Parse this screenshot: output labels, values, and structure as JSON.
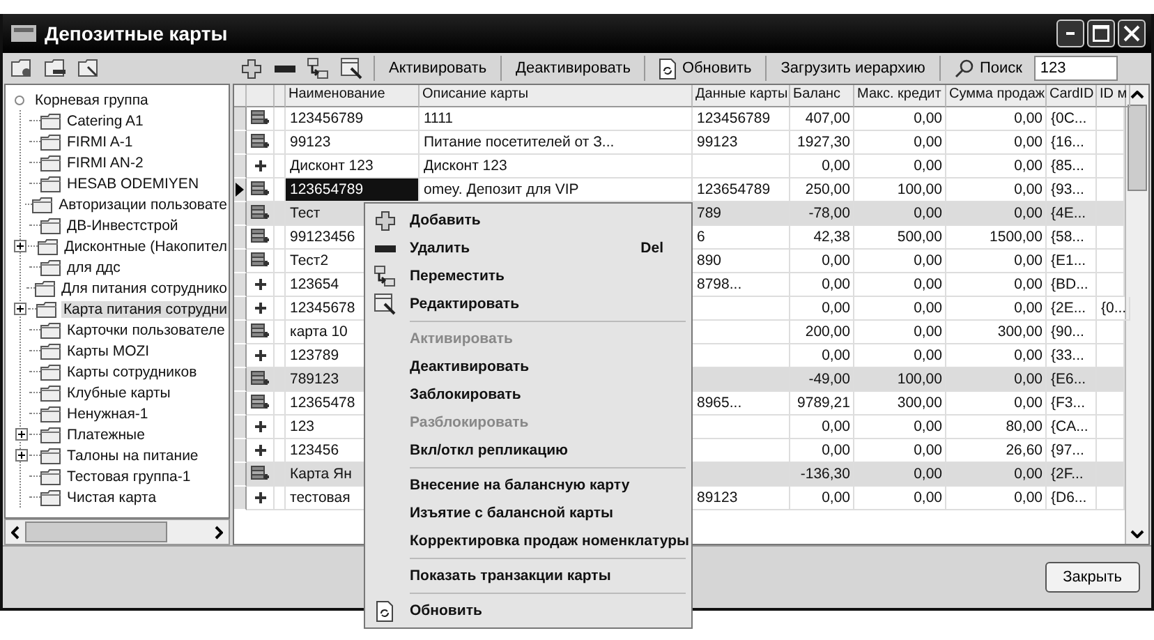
{
  "window": {
    "title": "Депозитные карты"
  },
  "toolbar": {
    "buttons": [
      {
        "label": "Активировать",
        "kind": "text"
      },
      {
        "label": "Деактивировать",
        "kind": "text"
      },
      {
        "label": "Обновить",
        "kind": "refresh"
      },
      {
        "label": "Загрузить иерархию",
        "kind": "text"
      }
    ],
    "search": {
      "label": "Поиск",
      "value": "123"
    }
  },
  "tree": {
    "root": {
      "label": "Корневая группа",
      "children": [
        {
          "label": "Catering A1",
          "has_children": false,
          "selected": false
        },
        {
          "label": "FIRMI A-1",
          "has_children": false,
          "selected": false
        },
        {
          "label": "FIRMI AN-2",
          "has_children": false,
          "selected": false
        },
        {
          "label": "HESAB ODEMIYEN",
          "has_children": false,
          "selected": false
        },
        {
          "label": "Авторизации пользовате",
          "has_children": false,
          "selected": false
        },
        {
          "label": "ДВ-Инвестстрой",
          "has_children": false,
          "selected": false
        },
        {
          "label": "Дисконтные (Накопител",
          "has_children": true,
          "selected": false
        },
        {
          "label": "для ддс",
          "has_children": false,
          "selected": false
        },
        {
          "label": "Для питания сотруднико",
          "has_children": false,
          "selected": false
        },
        {
          "label": "Карта питания сотрудни",
          "has_children": true,
          "selected": true
        },
        {
          "label": "Карточки пользователе",
          "has_children": false,
          "selected": false
        },
        {
          "label": "Карты MOZI",
          "has_children": false,
          "selected": false
        },
        {
          "label": "Карты сотрудников",
          "has_children": false,
          "selected": false
        },
        {
          "label": "Клубные карты",
          "has_children": false,
          "selected": false
        },
        {
          "label": "Ненужная-1",
          "has_children": false,
          "selected": false
        },
        {
          "label": "Платежные",
          "has_children": true,
          "selected": false
        },
        {
          "label": "Талоны на питание",
          "has_children": true,
          "selected": false
        },
        {
          "label": "Тестовая группа-1",
          "has_children": false,
          "selected": false
        },
        {
          "label": "Чистая карта",
          "has_children": false,
          "selected": false
        }
      ]
    }
  },
  "table": {
    "columns": [
      {
        "label": "Наименование"
      },
      {
        "label": "Описание карты"
      },
      {
        "label": "Данные карты"
      },
      {
        "label": "Баланс"
      },
      {
        "label": "Макс. кредит"
      },
      {
        "label": "Сумма продаж"
      },
      {
        "label": "CardID"
      },
      {
        "label": "ID м"
      }
    ],
    "rows": [
      {
        "kind": "stack",
        "selected": false,
        "highlighted": false,
        "name": "123456789",
        "description": "1111",
        "card_data": "123456789",
        "balance": "407,00",
        "max_credit": "0,00",
        "sales": "0,00",
        "card_id": "{0C..."
      },
      {
        "kind": "stack",
        "selected": false,
        "highlighted": false,
        "name": "99123",
        "description": "Питание посетителей от З...",
        "card_data": "99123",
        "balance": "1927,30",
        "max_credit": "0,00",
        "sales": "0,00",
        "card_id": "{16..."
      },
      {
        "kind": "plus",
        "selected": false,
        "highlighted": false,
        "name": "Дисконт 123",
        "description": "Дисконт 123",
        "balance": "0,00",
        "max_credit": "0,00",
        "sales": "0,00",
        "card_id": "{85..."
      },
      {
        "kind": "stack",
        "selected": true,
        "highlighted": false,
        "name": "123654789",
        "description": "omey. Депозит для VIP",
        "card_data": "123654789",
        "balance": "250,00",
        "max_credit": "100,00",
        "sales": "0,00",
        "card_id": "{93..."
      },
      {
        "kind": "stack",
        "selected": false,
        "highlighted": true,
        "name": "Тест",
        "card_data": "789",
        "balance": "-78,00",
        "max_credit": "0,00",
        "sales": "0,00",
        "card_id": "{4E..."
      },
      {
        "kind": "stack",
        "selected": false,
        "highlighted": false,
        "name": "99123456",
        "card_data": "6",
        "balance": "42,38",
        "max_credit": "500,00",
        "sales": "1500,00",
        "card_id": "{58..."
      },
      {
        "kind": "stack",
        "selected": false,
        "highlighted": false,
        "name": "Тест2",
        "card_data": "890",
        "balance": "0,00",
        "max_credit": "0,00",
        "sales": "0,00",
        "card_id": "{E1..."
      },
      {
        "kind": "plus",
        "selected": false,
        "highlighted": false,
        "name": "123654",
        "card_data": "8798...",
        "balance": "0,00",
        "max_credit": "0,00",
        "sales": "0,00",
        "card_id": "{BD..."
      },
      {
        "kind": "plus",
        "selected": false,
        "highlighted": false,
        "name": "12345678",
        "balance": "0,00",
        "max_credit": "0,00",
        "sales": "0,00",
        "card_id": "{2E...",
        "id": "{0..."
      },
      {
        "kind": "stack",
        "selected": false,
        "highlighted": false,
        "name": "карта 10",
        "balance": "200,00",
        "max_credit": "0,00",
        "sales": "300,00",
        "card_id": "{90..."
      },
      {
        "kind": "plus",
        "selected": false,
        "highlighted": false,
        "name": "123789",
        "balance": "0,00",
        "max_credit": "0,00",
        "sales": "0,00",
        "card_id": "{33..."
      },
      {
        "kind": "stack",
        "selected": false,
        "highlighted": true,
        "name": "789123",
        "balance": "-49,00",
        "max_credit": "100,00",
        "sales": "0,00",
        "card_id": "{E6..."
      },
      {
        "kind": "stack",
        "selected": false,
        "highlighted": false,
        "name": "12365478",
        "card_data": "8965...",
        "balance": "9789,21",
        "max_credit": "300,00",
        "sales": "0,00",
        "card_id": "{F3..."
      },
      {
        "kind": "plus",
        "selected": false,
        "highlighted": false,
        "name": "123",
        "balance": "0,00",
        "max_credit": "0,00",
        "sales": "80,00",
        "card_id": "{CA..."
      },
      {
        "kind": "plus",
        "selected": false,
        "highlighted": false,
        "name": "123456",
        "balance": "0,00",
        "max_credit": "0,00",
        "sales": "26,60",
        "card_id": "{97..."
      },
      {
        "kind": "stack",
        "selected": false,
        "highlighted": true,
        "name": "Карта Ян",
        "balance": "-136,30",
        "max_credit": "0,00",
        "sales": "0,00",
        "card_id": "{2F..."
      },
      {
        "kind": "plus",
        "selected": false,
        "highlighted": false,
        "name": "тестовая",
        "card_data": "89123",
        "balance": "0,00",
        "max_credit": "0,00",
        "sales": "0,00",
        "card_id": "{D6..."
      }
    ]
  },
  "context_menu": {
    "items": [
      {
        "kind": "add",
        "label": "Добавить",
        "disabled": false
      },
      {
        "kind": "delete",
        "label": "Удалить",
        "shortcut": "Del",
        "disabled": false
      },
      {
        "kind": "move",
        "label": "Переместить",
        "disabled": false
      },
      {
        "kind": "edit",
        "label": "Редактировать",
        "disabled": false
      },
      {
        "kind": "separator"
      },
      {
        "kind": "item",
        "label": "Активировать",
        "disabled": true
      },
      {
        "kind": "item",
        "label": "Деактивировать",
        "disabled": false
      },
      {
        "kind": "item",
        "label": "Заблокировать",
        "disabled": false
      },
      {
        "kind": "item",
        "label": "Разблокировать",
        "disabled": true
      },
      {
        "kind": "item",
        "label": "Вкл/откл репликацию",
        "disabled": false
      },
      {
        "kind": "separator"
      },
      {
        "kind": "item",
        "label": "Внесение на балансную карту",
        "disabled": false
      },
      {
        "kind": "item",
        "label": "Изъятие с балансной карты",
        "disabled": false
      },
      {
        "kind": "item",
        "label": "Корректировка продаж номенклатуры",
        "disabled": false
      },
      {
        "kind": "separator"
      },
      {
        "kind": "item",
        "label": "Показать транзакции карты",
        "disabled": false
      },
      {
        "kind": "separator"
      },
      {
        "kind": "refresh",
        "label": "Обновить",
        "disabled": false
      }
    ]
  },
  "footer": {
    "close_button": "Закрыть"
  }
}
